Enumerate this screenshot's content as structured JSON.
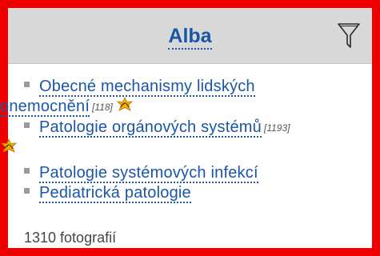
{
  "panel": {
    "title": "Alba",
    "filter_icon": "filter-icon",
    "items": [
      {
        "label_line1": "Obecné mechanismy lidských",
        "label_line2": "onemocnění",
        "count": "[118]",
        "icon": "new-badge-icon"
      },
      {
        "label": "Patologie orgánových systémů",
        "count": "[1193]",
        "icon": "new-badge-icon"
      },
      {
        "label": "Patologie systémových infekcí"
      },
      {
        "label": "Pediatrická patologie"
      }
    ],
    "footer": "1310 fotografií"
  },
  "colors": {
    "frame": "#ee0000",
    "header_bg": "#d8d8d8",
    "link": "#1a56a8",
    "badge": "#f0b400"
  }
}
